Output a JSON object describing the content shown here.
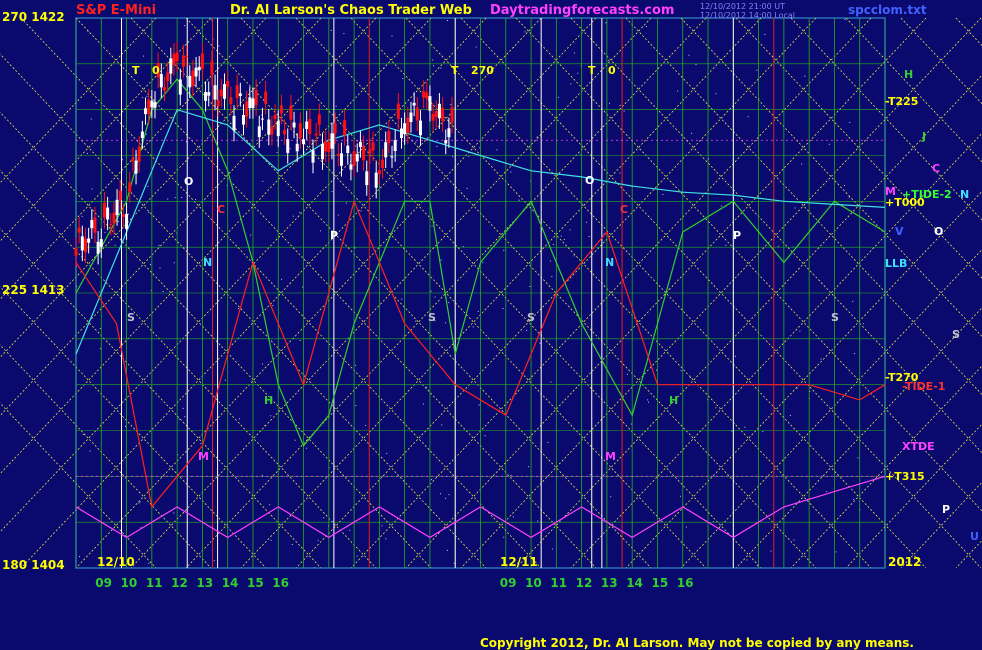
{
  "header": {
    "instrument": "S&P E-Mini",
    "site_title": "Dr. Al Larson's Chaos Trader Web",
    "url": "Daytradingforecasts.com",
    "file": "spcclom.txt",
    "stamp1": "12/10/2012 21:00 UT",
    "stamp2": "12/10/2012 14:00 Local"
  },
  "copyright": "Copyright 2012, Dr. Al Larson. May not be copied by any means.",
  "colors": {
    "background": "#0a0a6e",
    "price_up": "#ffffff",
    "price_down": "#ff1010",
    "tide": "#30d030",
    "ma_cyan": "#40e0e0",
    "flux_red": "#ff2020",
    "xtide": "#ff40ff",
    "grid_yellow": "#ffff40",
    "grid_green": "#20b020"
  },
  "chart_data": {
    "type": "line",
    "title": "S&P E-Mini",
    "y_axis_labels": [
      {
        "label": "270  1422",
        "price": 1422
      },
      {
        "label": "225  1413",
        "price": 1413
      },
      {
        "label": "180  1404",
        "price": 1404
      }
    ],
    "ylim": [
      1404,
      1422
    ],
    "x_hours_day1": [
      "09",
      "10",
      "11",
      "12",
      "13",
      "14",
      "15",
      "16"
    ],
    "x_hours_day2": [
      "09",
      "10",
      "11",
      "12",
      "13",
      "14",
      "15",
      "16"
    ],
    "date_labels": [
      "12/10",
      "12/11"
    ],
    "year_label": "2012",
    "right_labels": [
      {
        "text": "H",
        "color": "#30d030"
      },
      {
        "text": "-T225",
        "color": "#ffff00"
      },
      {
        "text": "J",
        "color": "#30d030"
      },
      {
        "text": "C",
        "color": "#ff40ff"
      },
      {
        "text": "M",
        "color": "#ff40ff"
      },
      {
        "text": "+TIDE-2",
        "color": "#30ff30"
      },
      {
        "text": "N",
        "color": "#40e0ff"
      },
      {
        "text": "+T000",
        "color": "#ffff00"
      },
      {
        "text": "V",
        "color": "#4060ff"
      },
      {
        "text": "O",
        "color": "#ffffff"
      },
      {
        "text": "LLB",
        "color": "#40e0ff"
      },
      {
        "text": "S",
        "color": "#c0c0d0"
      },
      {
        "text": "-T270",
        "color": "#ffff00"
      },
      {
        "text": "-TIDE-1",
        "color": "#ff3030"
      },
      {
        "text": "XTDE",
        "color": "#ff40ff"
      },
      {
        "text": "+T315",
        "color": "#ffff00"
      },
      {
        "text": "P",
        "color": "#ffffff"
      },
      {
        "text": "U",
        "color": "#4060ff"
      }
    ],
    "markers": [
      {
        "text": "T",
        "color": "#ffff00"
      },
      {
        "text": "0",
        "color": "#ffff00"
      },
      {
        "text": "T",
        "color": "#ffff00"
      },
      {
        "text": "270",
        "color": "#ffff00"
      },
      {
        "text": "T",
        "color": "#ffff00"
      },
      {
        "text": "0",
        "color": "#ffff00"
      },
      {
        "text": "O",
        "color": "#ffffff"
      },
      {
        "text": "O",
        "color": "#ffffff"
      },
      {
        "text": "C",
        "color": "#ff3030"
      },
      {
        "text": "C",
        "color": "#ff3030"
      },
      {
        "text": "P",
        "color": "#ffffff"
      },
      {
        "text": "P",
        "color": "#ffffff"
      },
      {
        "text": "N",
        "color": "#40e0ff"
      },
      {
        "text": "N",
        "color": "#40e0ff"
      },
      {
        "text": "S",
        "color": "#c0c0d0"
      },
      {
        "text": "S",
        "color": "#c0c0d0"
      },
      {
        "text": "S",
        "color": "#c0c0d0"
      },
      {
        "text": "S",
        "color": "#c0c0d0"
      },
      {
        "text": "H",
        "color": "#30d030"
      },
      {
        "text": "H",
        "color": "#30d030"
      },
      {
        "text": "M",
        "color": "#ff40ff"
      },
      {
        "text": "M",
        "color": "#ff40ff"
      }
    ],
    "series": [
      {
        "name": "price_close",
        "x": [
          0,
          0.5,
          1,
          1.5,
          2,
          2.5,
          3,
          3.5,
          4,
          4.5,
          5,
          5.5,
          6,
          6.5,
          7,
          7.5
        ],
        "values": [
          1414.5,
          1415.2,
          1416.0,
          1419.5,
          1420.5,
          1420.0,
          1419.3,
          1419.0,
          1418.5,
          1418.2,
          1418.0,
          1417.6,
          1417.2,
          1418.6,
          1419.2,
          1418.0
        ]
      },
      {
        "name": "TIDE-2",
        "x": [
          0,
          1,
          1.5,
          2,
          2.5,
          3,
          3.5,
          4,
          4.5,
          5,
          5.5,
          6,
          6.5,
          7,
          7.5,
          8,
          9,
          10,
          11,
          12,
          13,
          14,
          15,
          16
        ],
        "values": [
          1413,
          1416,
          1419,
          1420,
          1419,
          1417,
          1414,
          1410,
          1408,
          1409,
          1412,
          1414,
          1416,
          1416,
          1411,
          1414,
          1416,
          1412,
          1409,
          1415,
          1416,
          1414,
          1416,
          1415
        ]
      },
      {
        "name": "MA cyan",
        "x": [
          0,
          1,
          2,
          3,
          4,
          5,
          6,
          7,
          8,
          9,
          10,
          11,
          12,
          13,
          14,
          15,
          16
        ],
        "values": [
          1411,
          1415,
          1419,
          1418.5,
          1417,
          1418,
          1418.5,
          1418,
          1417.5,
          1417,
          1416.8,
          1416.5,
          1416.3,
          1416.2,
          1416.0,
          1415.9,
          1415.8
        ]
      },
      {
        "name": "TIDE-1",
        "x": [
          0,
          0.8,
          1.5,
          2.5,
          3.5,
          4.5,
          5.5,
          6.5,
          7.5,
          8.5,
          9.5,
          10.5,
          11.5,
          12.5,
          13.5,
          14.5,
          15.5,
          16
        ],
        "values": [
          1414,
          1412,
          1406,
          1408,
          1414,
          1410,
          1416,
          1412,
          1410,
          1409,
          1413,
          1415,
          1410,
          1410,
          1410,
          1410,
          1409.5,
          1410
        ]
      },
      {
        "name": "XTIDE",
        "x": [
          0,
          1,
          2,
          3,
          4,
          5,
          6,
          7,
          8,
          9,
          10,
          11,
          12,
          13,
          14,
          15,
          16
        ],
        "values": [
          1406,
          1405,
          1406,
          1405,
          1406,
          1405,
          1406,
          1405,
          1406,
          1405,
          1406,
          1405,
          1406,
          1405,
          1406,
          1406.5,
          1407
        ]
      }
    ]
  }
}
